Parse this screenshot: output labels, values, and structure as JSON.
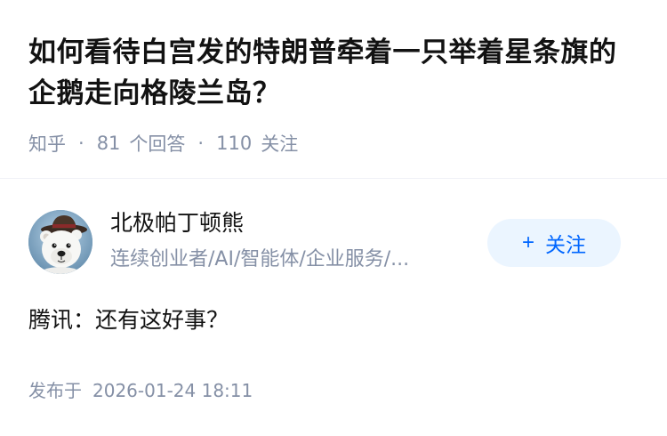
{
  "question": {
    "title": "如何看待白宫发的特朗普牵着一只举着星条旗的企鹅走向格陵兰岛？",
    "source": "知乎",
    "separator": "·",
    "answer_count": "81",
    "answer_label": "个回答",
    "follower_count": "110",
    "follower_label": "关注"
  },
  "author": {
    "avatar_icon": "polar-bear-avatar-icon",
    "name": "北极帕丁顿熊",
    "headline": "连续创业者/AI/智能体/企业服务/..."
  },
  "follow_button": {
    "plus": "+",
    "label": "关注"
  },
  "answer": {
    "content": "腾讯：还有这好事？"
  },
  "publish": {
    "label": "发布于",
    "date": "2026-01-24 18:11"
  },
  "colors": {
    "primary_text": "#121212",
    "secondary_text": "#8590a6",
    "brand_blue": "#0066ff",
    "follow_bg": "#ebf5ff"
  }
}
